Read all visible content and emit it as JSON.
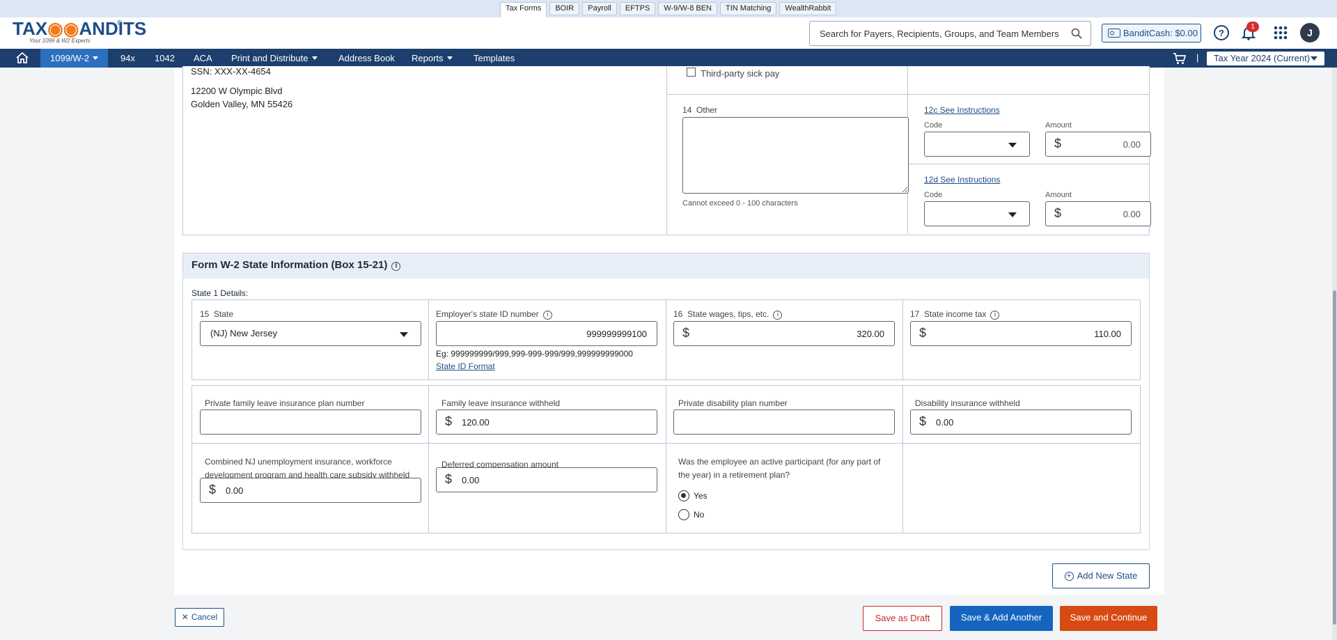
{
  "product_tabs": [
    "Tax Forms",
    "BOIR",
    "Payroll",
    "EFTPS",
    "W-9/W-8 BEN",
    "TIN Matching",
    "WealthRabbit"
  ],
  "logo": {
    "brand_left": "TAX",
    "brand_right": "ANDITS",
    "tagline": "Your 1099 & W2 Experts",
    "reg": "®"
  },
  "search": {
    "placeholder": "Search for Payers, Recipients, Groups, and Team Members"
  },
  "bandit_cash": {
    "label": "BanditCash:",
    "value": "$0.00"
  },
  "notifications": {
    "count": "1"
  },
  "user": {
    "initial": "J"
  },
  "nav": {
    "items": [
      {
        "label": "1099/W-2"
      },
      {
        "label": "94x"
      },
      {
        "label": "1042"
      },
      {
        "label": "ACA"
      },
      {
        "label": "Print and Distribute"
      },
      {
        "label": "Address Book"
      },
      {
        "label": "Reports"
      },
      {
        "label": "Templates"
      }
    ],
    "tax_year": "Tax Year 2024 (Current)",
    "pipe": "|"
  },
  "employee": {
    "ssn": "SSN: XXX-XX-4654",
    "address_line1": "12200 W Olympic Blvd",
    "address_line2": "Golden Valley, MN 55426"
  },
  "box13": {
    "third_party_label": "Third-party sick pay",
    "checked": false
  },
  "box14": {
    "number": "14",
    "label": "Other",
    "value": "",
    "hint": "Cannot exceed 0 - 100 characters"
  },
  "box12c": {
    "link": "12c See Instructions",
    "code_label": "Code",
    "amount_label": "Amount",
    "code_value": "",
    "amount": "0.00"
  },
  "box12d": {
    "link": "12d See Instructions",
    "code_label": "Code",
    "amount_label": "Amount",
    "code_value": "",
    "amount": "0.00"
  },
  "state_section": {
    "title": "Form W-2 State Information (Box 15-21)",
    "state1_label": "State 1 Details:",
    "state": {
      "number": "15",
      "label": "State",
      "value": "(NJ) New Jersey"
    },
    "employer_state_id": {
      "label": "Employer's state ID number",
      "value": "999999999100",
      "example": "Eg: 999999999/999,999-999-999/999,999999999000",
      "format_link": "State ID Format"
    },
    "state_wages": {
      "number": "16",
      "label": "State wages, tips, etc.",
      "value": "320.00"
    },
    "state_income_tax": {
      "number": "17",
      "label": "State income tax",
      "value": "110.00"
    },
    "private_family_leave": {
      "label": "Private family leave insurance plan number",
      "value": ""
    },
    "family_leave_withheld": {
      "label": "Family leave insurance withheld",
      "value": "120.00"
    },
    "private_disability": {
      "label": "Private disability plan number",
      "value": ""
    },
    "disability_withheld": {
      "label": "Disability insurance withheld",
      "value": "0.00"
    },
    "combined_nj": {
      "label_line1": "Combined NJ unemployment insurance, workforce",
      "label_line2": "development program and health care subsidy withheld",
      "value": "0.00"
    },
    "deferred_comp": {
      "label": "Deferred compensation amount",
      "value": "0.00"
    },
    "retirement": {
      "question_line1": "Was the employee an active participant (for any part of",
      "question_line2": "the year) in a retirement plan?",
      "yes": "Yes",
      "no": "No",
      "selected": "Yes"
    }
  },
  "buttons": {
    "add_state": "Add New State",
    "cancel": "Cancel",
    "save_draft": "Save as Draft",
    "save_add_another": "Save & Add Another",
    "save_continue": "Save and Continue"
  },
  "colors": {
    "nav": "#1d3f6e",
    "nav_active": "#2c6fbe",
    "brand": "#1d4e89",
    "accent_orange": "#d84a14",
    "blue_button": "#1565c0",
    "draft_red": "#c62828"
  }
}
